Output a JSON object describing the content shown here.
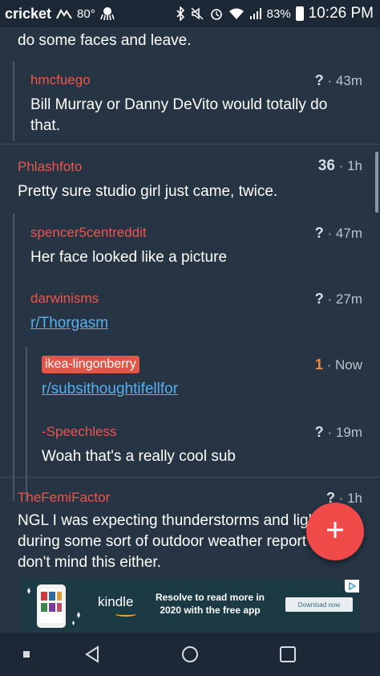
{
  "status_bar": {
    "carrier": "cricket",
    "temperature": "80°",
    "battery": "83%",
    "time": "10:26 PM"
  },
  "comments": [
    {
      "body": "do some faces and leave."
    },
    {
      "author": "hmcfuego",
      "score": "?",
      "age": "43m",
      "body": "Bill Murray or Danny DeVito would totally do that."
    },
    {
      "author": "Phlashfoto",
      "score": "36",
      "age": "1h",
      "body": "Pretty sure studio girl just came, twice."
    },
    {
      "author": "spencer5centreddit",
      "score": "?",
      "age": "47m",
      "body": "Her face looked like a picture"
    },
    {
      "author": "darwinisms",
      "score": "?",
      "age": "27m",
      "link": "r/Thorgasm"
    },
    {
      "author": "ikea-lingonberry",
      "score": "1",
      "age": "Now",
      "link": "r/subsithoughtifellfor"
    },
    {
      "author": "-Speechless",
      "score": "?",
      "age": "19m",
      "body": "Woah that's a really cool sub"
    },
    {
      "author": "TheFemiFactor",
      "score": "?",
      "age": "1h",
      "body": "NGL I was expecting thunderstorms and lightning during some sort of outdoor weather report but I don't mind this either."
    }
  ],
  "separator": "·",
  "ad": {
    "brand": "kindle",
    "headline": "Resolve to read more in 2020 with the free app",
    "cta": "Download now"
  },
  "colors": {
    "background": "#263444",
    "author": "#e8584c",
    "link": "#56b0f0",
    "fab": "#ef4a48",
    "upvoted": "#f08a3c"
  },
  "icons": [
    "weather-icon",
    "octopus-icon",
    "bluetooth-icon",
    "mute-icon",
    "alarm-icon",
    "wifi-icon",
    "signal-icon",
    "battery-icon",
    "plus-icon",
    "square-nav-icon",
    "back-icon",
    "home-icon",
    "recents-icon",
    "adchoices-icon"
  ]
}
